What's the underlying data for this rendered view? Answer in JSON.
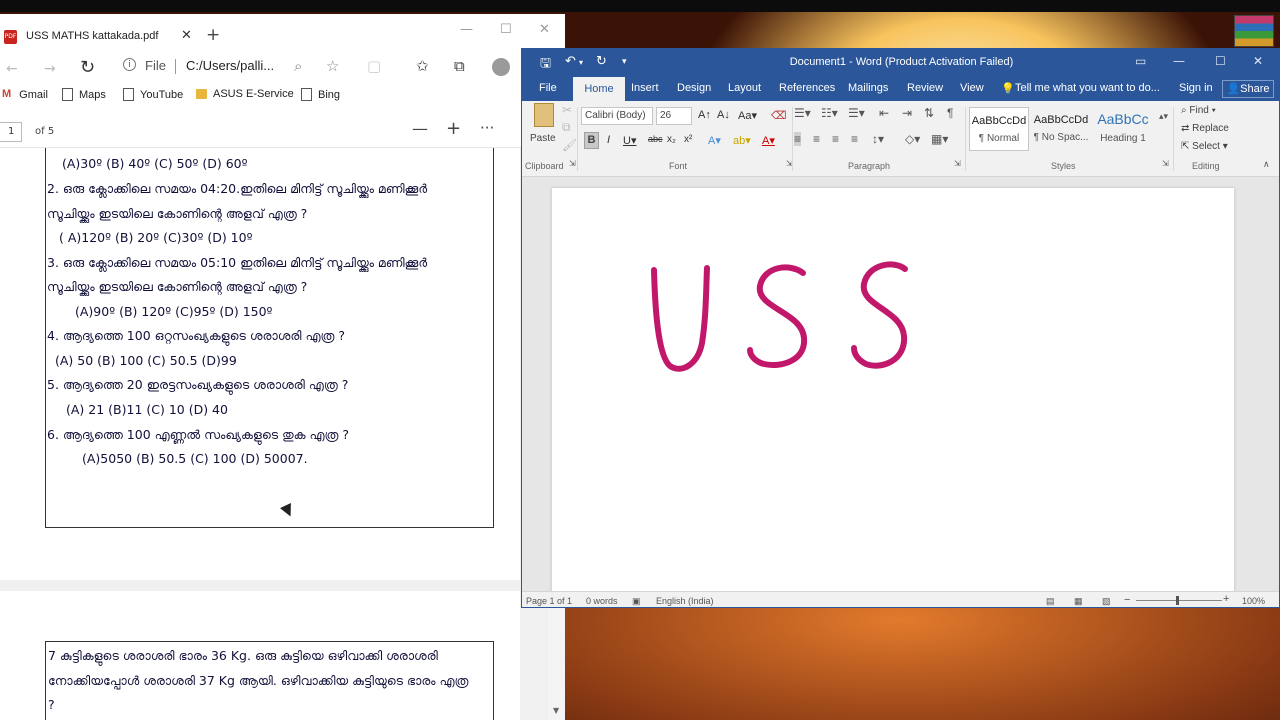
{
  "edge": {
    "tab_title": "USS MATHS kattakada.pdf",
    "address": {
      "scheme_label": "File",
      "url": "C:/Users/palli..."
    },
    "favorites": [
      "Gmail",
      "Maps",
      "YouTube",
      "ASUS E-Service",
      "Bing"
    ],
    "pdf": {
      "page_input": "1",
      "page_of": "of 5"
    }
  },
  "pdf_content": {
    "lines": [
      "(A)30º        (B) 40º          (C) 50º            (D) 60º",
      "2.   ഒരു ക്ലോക്കിലെ സമയം 04:20.ഇതിലെ മിനിട്ട് സൂചിയ്ക്കും മണിക്കൂർ",
      "സൂചിയ്ക്കും ഇടയിലെ കോണിന്റെ അളവ് എത്ര ?",
      "( A)120º        (B) 20º           (C)30º             (D) 10º",
      "3.  ഒരു ക്ലോക്കിലെ സമയം 05:10 ഇതിലെ മിനിട്ട് സൂചിയ്ക്കും മണിക്കൂർ",
      "സൂചിയ്ക്കും ഇടയിലെ കോണിന്റെ അളവ് എത്ര ?",
      "(A)90º        (B) 120º          (C)95º            (D) 150º",
      "4.   ആദ്യത്തെ 100 ഒറ്റസംഖ്യകളുടെ ശരാശരി എത്ര ?",
      "(A) 50           (B) 100           (C)    50.5          (D)99",
      "5.   ആദ്യത്തെ 20 ഇരട്ടസംഖ്യകളുടെ ശരാശരി എത്ര ?",
      "(A) 21            (B)11              (C) 10             (D) 40",
      "6.   ആദ്യത്തെ 100 എണ്ണൽ സംഖ്യകളുടെ തുക എത്ര ?",
      "(A)5050        (B) 50.5         (C) 100             (D)    50007."
    ],
    "page2_lines": [
      "7 കുട്ടികളുടെ ശരാശരി ഭാരം 36 Kg. ഒരു കുട്ടിയെ ഒഴിവാക്കി ശരാശരി",
      "നോക്കിയപ്പോൾ ശരാശരി 37 Kg ആയി. ഒഴിവാക്കിയ കുട്ടിയുടെ ഭാരം എത്ര",
      "?"
    ]
  },
  "word": {
    "title": "Document1 - Word (Product Activation Failed)",
    "tabs": [
      "File",
      "Home",
      "Insert",
      "Design",
      "Layout",
      "References",
      "Mailings",
      "Review",
      "View"
    ],
    "tell_me": "Tell me what you want to do...",
    "sign_in": "Sign in",
    "share": "Share",
    "ribbon": {
      "paste": "Paste",
      "font_name": "Calibri (Body)",
      "font_size": "26",
      "groups": [
        "Clipboard",
        "Font",
        "Paragraph",
        "Styles",
        "Editing"
      ],
      "styles": [
        {
          "sample": "AaBbCcDd",
          "name": "¶ Normal"
        },
        {
          "sample": "AaBbCcDd",
          "name": "¶ No Spac..."
        },
        {
          "sample": "AaBbCc",
          "name": "Heading 1"
        }
      ],
      "editing": [
        "Find",
        "Replace",
        "Select"
      ]
    },
    "status": {
      "page": "Page 1 of 1",
      "words": "0 words",
      "language": "English (India)",
      "zoom": "100%"
    },
    "ink_text": "USS",
    "ink_color": "#c2186b"
  }
}
